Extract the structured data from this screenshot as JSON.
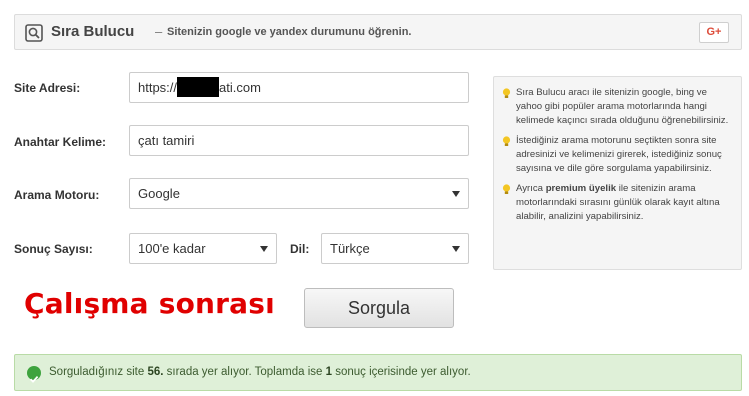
{
  "header": {
    "title": "Sıra Bulucu",
    "separator": "–",
    "subtitle": "Sitenizin google ve yandex durumunu öğrenin.",
    "share_label": "G+",
    "icons": {
      "title_icon": "search-window-icon",
      "share_icon": "google-plus-icon"
    }
  },
  "form": {
    "site_label": "Site Adresi:",
    "site_value_prefix": "https://",
    "site_value_suffix": "ati.com",
    "keyword_label": "Anahtar Kelime:",
    "keyword_value": "çatı tamiri",
    "engine_label": "Arama Motoru:",
    "engine_value": "Google",
    "count_label": "Sonuç Sayısı:",
    "count_value": "100'e kadar",
    "lang_label": "Dil:",
    "lang_value": "Türkçe"
  },
  "info": {
    "tip1": "Sıra Bulucu aracı ile sitenizin google, bing ve yahoo gibi popüler arama motorlarında hangi kelimede kaçıncı sırada olduğunu öğrenebilirsiniz.",
    "tip2": "İstediğiniz arama motorunu seçtikten sonra site adresinizi ve kelimenizi girerek, istediğiniz sonuç sayısına ve dile göre sorgulama yapabilirsiniz.",
    "tip3_pre": "Ayrıca ",
    "tip3_bold": "premium üyelik",
    "tip3_post": " ile sitenizin arama motorlarındaki sırasını günlük olarak kayıt altına alabilir, analizini yapabilirsiniz.",
    "tip_icon": "lightbulb-icon"
  },
  "annotation": "Çalışma sonrası",
  "submit_label": "Sorgula",
  "result": {
    "part1": "Sorguladığınız site ",
    "rank": "56.",
    "part2": " sırada yer alıyor. Toplamda ise ",
    "total": "1",
    "part3": " sonuç içerisinde yer alıyor.",
    "icon": "check-circle-icon"
  },
  "colors": {
    "annotation": "#e00000",
    "alert_bg": "#dff0d8",
    "google_plus": "#dd4b39"
  }
}
